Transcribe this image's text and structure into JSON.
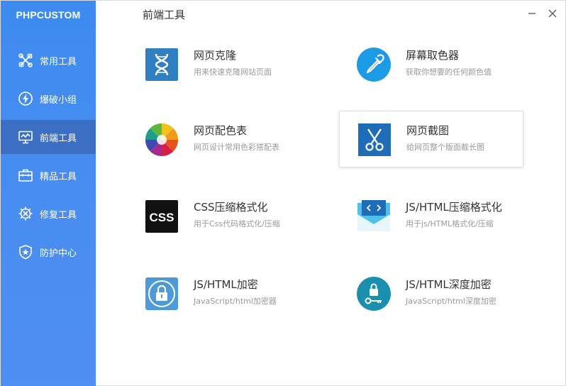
{
  "app": {
    "brand": "PHPCUSTOM"
  },
  "sidebar": {
    "items": [
      {
        "label": "常用工具",
        "icon": "tools-icon"
      },
      {
        "label": "爆破小组",
        "icon": "lightning-icon"
      },
      {
        "label": "前端工具",
        "icon": "monitor-icon",
        "active": true
      },
      {
        "label": "精品工具",
        "icon": "toolbox-icon"
      },
      {
        "label": "修复工具",
        "icon": "repair-icon"
      },
      {
        "label": "防护中心",
        "icon": "shield-icon"
      }
    ]
  },
  "header": {
    "title": "前端工具"
  },
  "colors": {
    "sidebar": "#4a8df1",
    "active": "#3c6fc4",
    "accent": "#1b9ae6"
  },
  "tools": [
    {
      "title": "网页克隆",
      "desc": "用来快速克隆网站页面",
      "icon": "dna-icon"
    },
    {
      "title": "屏幕取色器",
      "desc": "获取你想要的任何颜色值",
      "icon": "eyedropper-icon"
    },
    {
      "title": "网页配色表",
      "desc": "网页设计常用色彩搭配表",
      "icon": "color-wheel-icon"
    },
    {
      "title": "网页截图",
      "desc": "给网页整个版面截长图",
      "icon": "scissors-icon"
    },
    {
      "title": "CSS压缩格式化",
      "desc": "用于Css代码格式化/压缩",
      "icon": "css-icon"
    },
    {
      "title": "JS/HTML压缩格式化",
      "desc": "用于js/HTML格式化/压缩",
      "icon": "code-envelope-icon"
    },
    {
      "title": "JS/HTML加密",
      "desc": "JavaScript/html加密器",
      "icon": "lock-icon"
    },
    {
      "title": "JS/HTML深度加密",
      "desc": "JavaScript/html深度加密",
      "icon": "lock-key-icon"
    }
  ]
}
